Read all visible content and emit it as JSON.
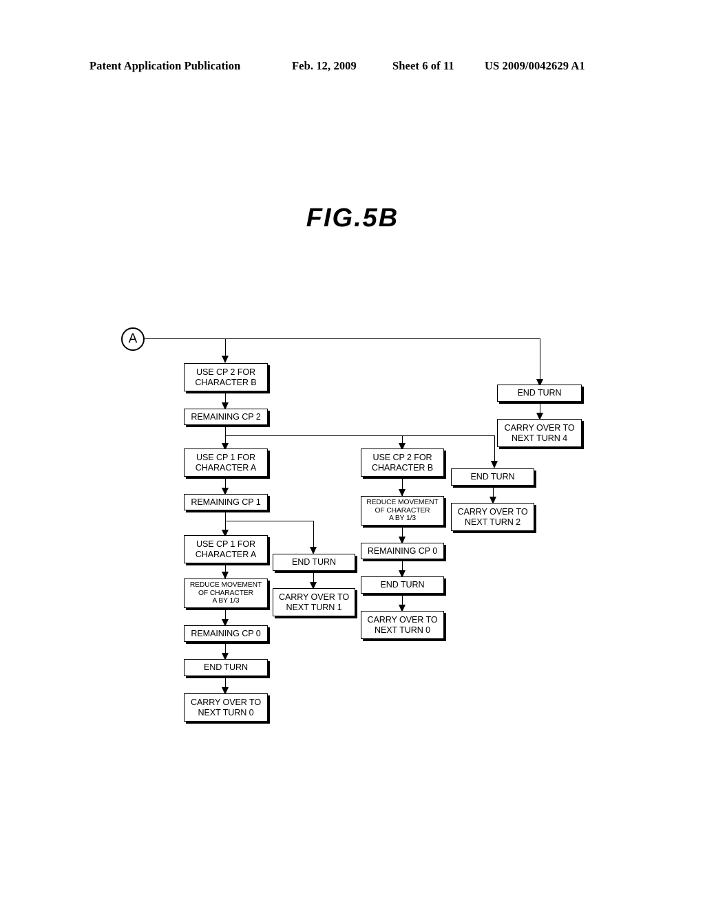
{
  "header": {
    "publication": "Patent Application Publication",
    "date": "Feb. 12, 2009",
    "sheet": "Sheet 6 of 11",
    "patent_number": "US 2009/0042629 A1"
  },
  "figure": {
    "title": "FIG.5B",
    "connector_label": "A"
  },
  "nodes": {
    "use_cp2_b_1": {
      "line1": "USE CP 2 FOR",
      "line2": "CHARACTER B"
    },
    "remaining_cp2": {
      "line1": "REMAINING CP 2"
    },
    "use_cp1_a_1": {
      "line1": "USE CP 1 FOR",
      "line2": "CHARACTER A"
    },
    "remaining_cp1": {
      "line1": "REMAINING CP 1"
    },
    "use_cp1_a_2": {
      "line1": "USE CP 1 FOR",
      "line2": "CHARACTER A"
    },
    "reduce_left": {
      "line1": "REDUCE MOVEMENT",
      "line2": "OF CHARACTER",
      "line3": "A  BY 1/3"
    },
    "remaining_cp0_left": {
      "line1": "REMAINING CP 0"
    },
    "end_turn_left": {
      "line1": "END TURN"
    },
    "carry_left": {
      "line1": "CARRY OVER TO",
      "line2": "NEXT TURN 0"
    },
    "end_turn_col2": {
      "line1": "END TURN"
    },
    "carry_col2": {
      "line1": "CARRY OVER TO",
      "line2": "NEXT TURN 1"
    },
    "use_cp2_b_2": {
      "line1": "USE CP 2 FOR",
      "line2": "CHARACTER B"
    },
    "reduce_mid": {
      "line1": "REDUCE MOVEMENT",
      "line2": "OF CHARACTER",
      "line3": "A  BY 1/3"
    },
    "remaining_cp0_mid": {
      "line1": "REMAINING CP 0"
    },
    "end_turn_mid": {
      "line1": "END TURN"
    },
    "carry_mid": {
      "line1": "CARRY OVER TO",
      "line2": "NEXT TURN 0"
    },
    "end_turn_col4": {
      "line1": "END TURN"
    },
    "carry_col4": {
      "line1": "CARRY OVER TO",
      "line2": "NEXT TURN 2"
    },
    "end_turn_col5": {
      "line1": "END TURN"
    },
    "carry_col5": {
      "line1": "CARRY OVER TO",
      "line2": "NEXT TURN 4"
    }
  },
  "colors": {
    "ink": "#000000",
    "paper": "#ffffff"
  }
}
